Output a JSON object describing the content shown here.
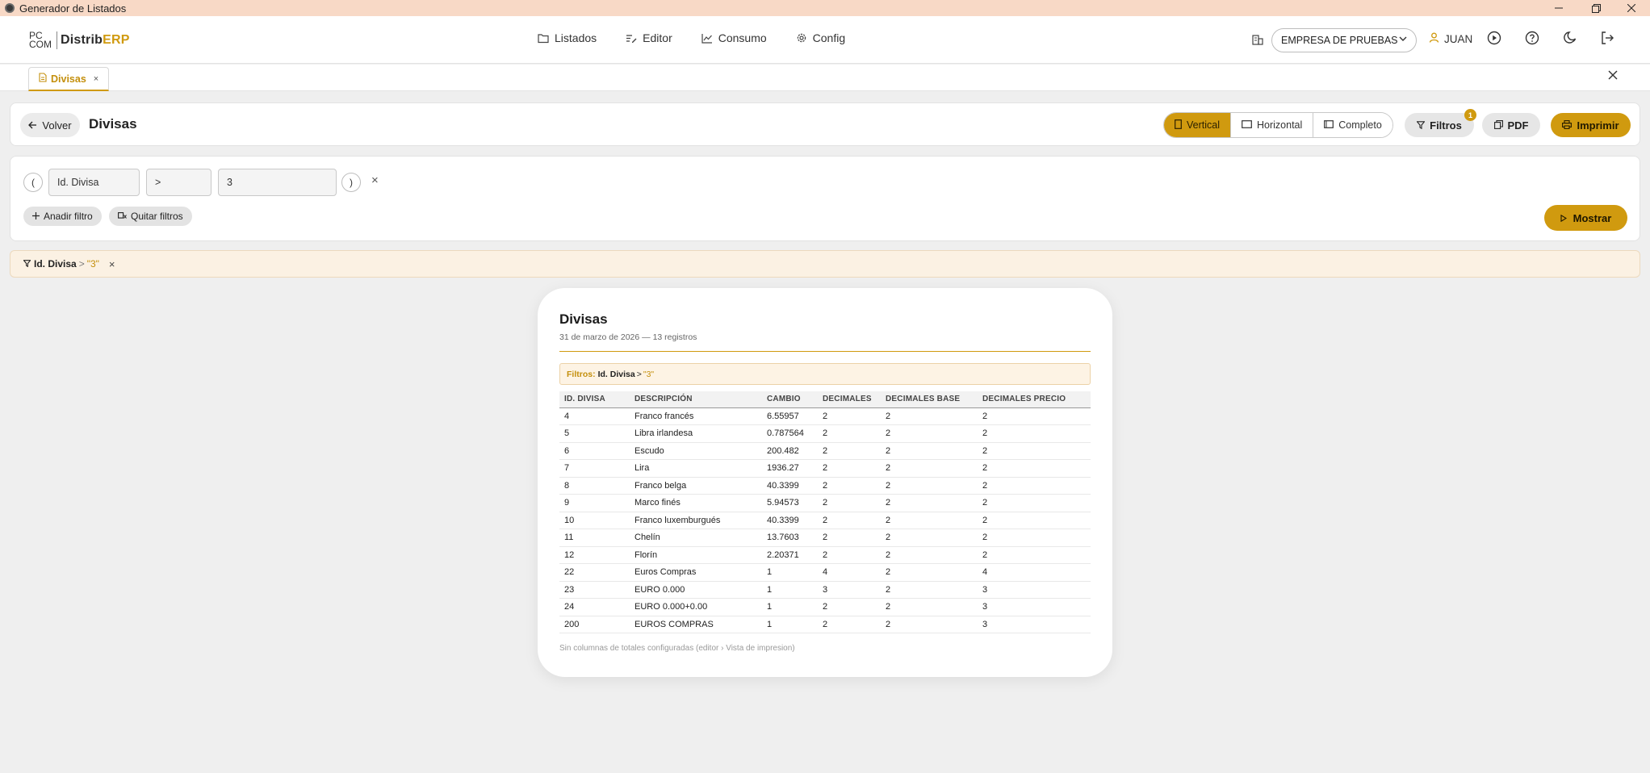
{
  "window": {
    "title": "Generador de Listados",
    "minimize_icon": "minimize-icon",
    "restore_icon": "restore-icon",
    "close_icon": "close-icon"
  },
  "header": {
    "logo": {
      "pc": "PC",
      "com": "COM",
      "brand_main": "Distrib",
      "brand_accent": "ERP"
    },
    "nav": [
      {
        "label": "Listados",
        "icon": "folder-icon"
      },
      {
        "label": "Editor",
        "icon": "edit-list-icon"
      },
      {
        "label": "Consumo",
        "icon": "chart-line-icon"
      },
      {
        "label": "Config",
        "icon": "gear-icon"
      }
    ],
    "company": "EMPRESA DE PRUEBAS",
    "user": "JUAN"
  },
  "tabs": [
    {
      "label": "Divisas",
      "close": "×"
    }
  ],
  "toolbar": {
    "back_label": "Volver",
    "title": "Divisas",
    "orientation": [
      {
        "label": "Vertical",
        "active": true
      },
      {
        "label": "Horizontal",
        "active": false
      },
      {
        "label": "Completo",
        "active": false
      }
    ],
    "filters_label": "Filtros",
    "filters_count": "1",
    "pdf_label": "PDF",
    "print_label": "Imprimir"
  },
  "filter_builder": {
    "open_paren": "(",
    "close_paren": ")",
    "field": "Id. Divisa",
    "operator": ">",
    "value": "3",
    "remove": "×",
    "add_label": "Anadir filtro",
    "clear_label": "Quitar filtros",
    "show_label": "Mostrar"
  },
  "active_filter": {
    "field": "Id. Divisa",
    "operator": ">",
    "value": "\"3\"",
    "remove": "×"
  },
  "report": {
    "title": "Divisas",
    "subtitle": "31 de marzo de 2026 — 13 registros",
    "filters_label": "Filtros:",
    "filter_field": "Id. Divisa",
    "filter_op": ">",
    "filter_value": "\"3\"",
    "columns": [
      "ID. DIVISA",
      "DESCRIPCIÓN",
      "CAMBIO",
      "DECIMALES",
      "DECIMALES BASE",
      "DECIMALES PRECIO"
    ],
    "rows": [
      [
        "4",
        "Franco francés",
        "6.55957",
        "2",
        "2",
        "2"
      ],
      [
        "5",
        "Libra irlandesa",
        "0.787564",
        "2",
        "2",
        "2"
      ],
      [
        "6",
        "Escudo",
        "200.482",
        "2",
        "2",
        "2"
      ],
      [
        "7",
        "Lira",
        "1936.27",
        "2",
        "2",
        "2"
      ],
      [
        "8",
        "Franco belga",
        "40.3399",
        "2",
        "2",
        "2"
      ],
      [
        "9",
        "Marco finés",
        "5.94573",
        "2",
        "2",
        "2"
      ],
      [
        "10",
        "Franco luxemburgués",
        "40.3399",
        "2",
        "2",
        "2"
      ],
      [
        "11",
        "Chelín",
        "13.7603",
        "2",
        "2",
        "2"
      ],
      [
        "12",
        "Florín",
        "2.20371",
        "2",
        "2",
        "2"
      ],
      [
        "22",
        "Euros Compras",
        "1",
        "4",
        "2",
        "4"
      ],
      [
        "23",
        "EURO 0.000",
        "1",
        "3",
        "2",
        "3"
      ],
      [
        "24",
        "EURO 0.000+0.00",
        "1",
        "2",
        "2",
        "3"
      ],
      [
        "200",
        "EUROS COMPRAS",
        "1",
        "2",
        "2",
        "3"
      ]
    ],
    "footer": "Sin columnas de totales configuradas (editor › Vista de impresion)"
  },
  "colors": {
    "accent": "#d09a0f",
    "titlebar": "#f8d9c6",
    "background": "#efefef"
  }
}
